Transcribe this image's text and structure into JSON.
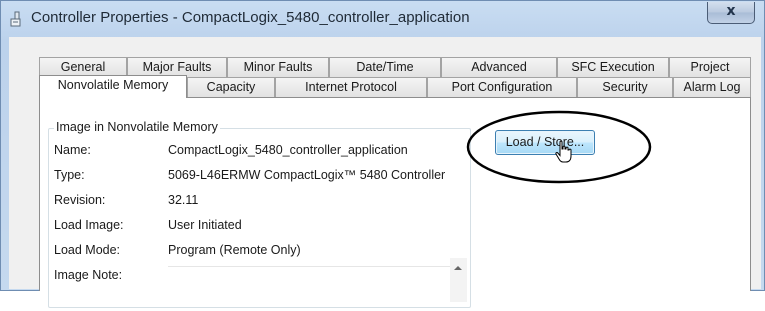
{
  "window": {
    "title": "Controller Properties - CompactLogix_5480_controller_application",
    "close_glyph": "x",
    "icon": "controller-properties-icon"
  },
  "tabs": {
    "row1": [
      "General",
      "Major Faults",
      "Minor Faults",
      "Date/Time",
      "Advanced",
      "SFC Execution",
      "Project"
    ],
    "row2": [
      "Nonvolatile Memory",
      "Capacity",
      "Internet Protocol",
      "Port Configuration",
      "Security",
      "Alarm Log"
    ],
    "active": "Nonvolatile Memory"
  },
  "image_group": {
    "title": "Image in Nonvolatile Memory",
    "fields": [
      {
        "label": "Name:",
        "value": "CompactLogix_5480_controller_application"
      },
      {
        "label": "Type:",
        "value": "5069-L46ERMW CompactLogix™ 5480 Controller"
      },
      {
        "label": "Revision:",
        "value": "32.11"
      },
      {
        "label": "Load Image:",
        "value": "User Initiated"
      },
      {
        "label": "Load Mode:",
        "value": "Program (Remote Only)"
      },
      {
        "label": "Image Note:",
        "value": ""
      }
    ]
  },
  "load_store_button": {
    "label": "Load / Store..."
  },
  "colors": {
    "title_bar": "#c9ddf2",
    "button_border": "#3c7fb1",
    "callout": "#000000"
  }
}
